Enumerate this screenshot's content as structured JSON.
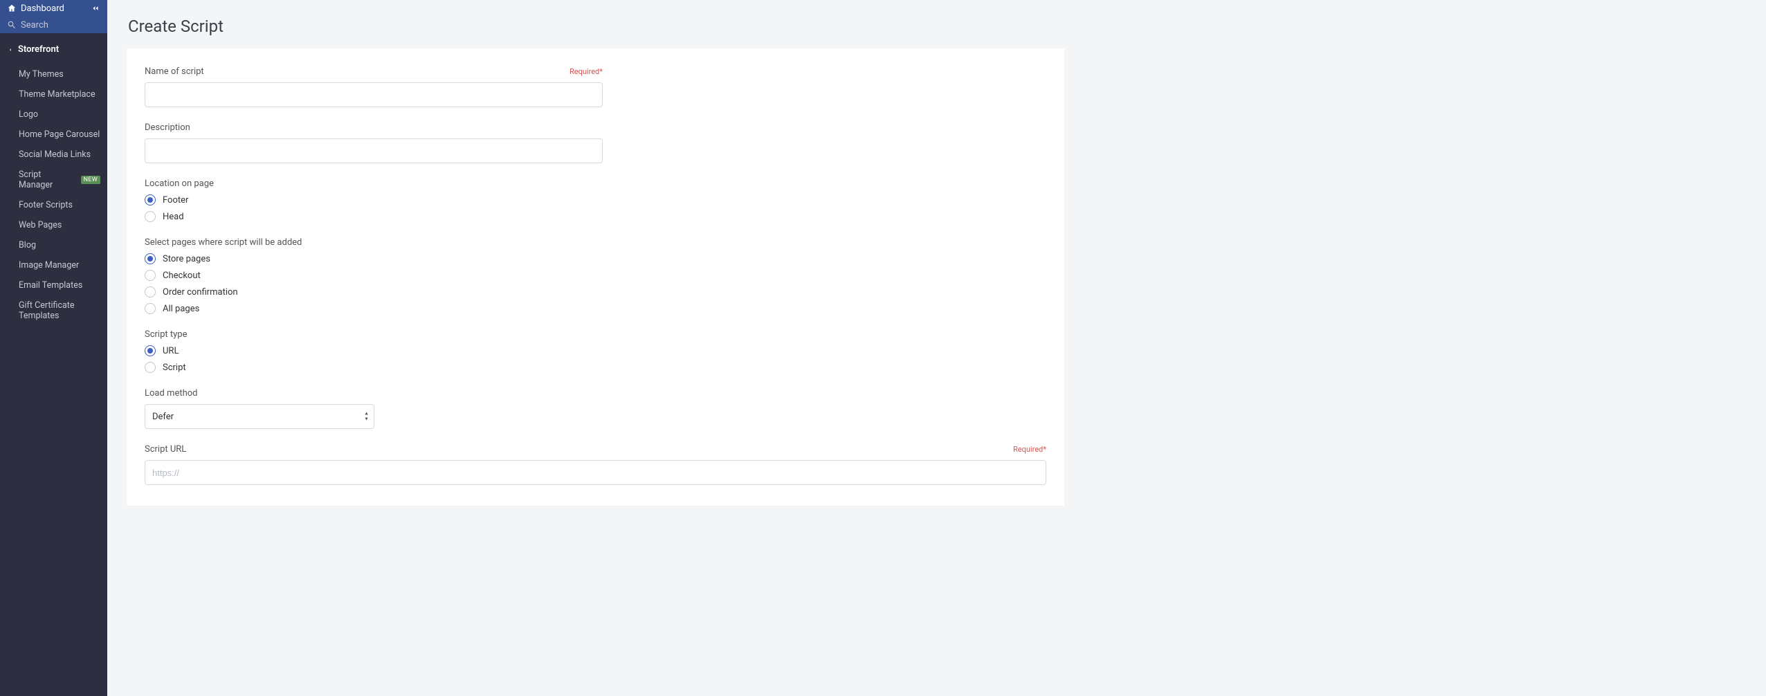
{
  "sidebar": {
    "dashboard_label": "Dashboard",
    "search_label": "Search",
    "section_title": "Storefront",
    "items": [
      {
        "label": "My Themes"
      },
      {
        "label": "Theme Marketplace"
      },
      {
        "label": "Logo"
      },
      {
        "label": "Home Page Carousel"
      },
      {
        "label": "Social Media Links"
      },
      {
        "label": "Script Manager",
        "badge": "NEW"
      },
      {
        "label": "Footer Scripts"
      },
      {
        "label": "Web Pages"
      },
      {
        "label": "Blog"
      },
      {
        "label": "Image Manager"
      },
      {
        "label": "Email Templates"
      },
      {
        "label": "Gift Certificate Templates"
      }
    ]
  },
  "page": {
    "title": "Create Script",
    "required_label": "Required*"
  },
  "form": {
    "name_label": "Name of script",
    "name_value": "",
    "description_label": "Description",
    "description_value": "",
    "location_label": "Location on page",
    "location_options": {
      "footer": "Footer",
      "head": "Head"
    },
    "location_selected": "footer",
    "pages_label": "Select pages where script will be added",
    "pages_options": {
      "store": "Store pages",
      "checkout": "Checkout",
      "order_confirmation": "Order confirmation",
      "all": "All pages"
    },
    "pages_selected": "store",
    "script_type_label": "Script type",
    "script_type_options": {
      "url": "URL",
      "script": "Script"
    },
    "script_type_selected": "url",
    "load_method_label": "Load method",
    "load_method_value": "Defer",
    "script_url_label": "Script URL",
    "script_url_placeholder": "https://",
    "script_url_value": ""
  }
}
